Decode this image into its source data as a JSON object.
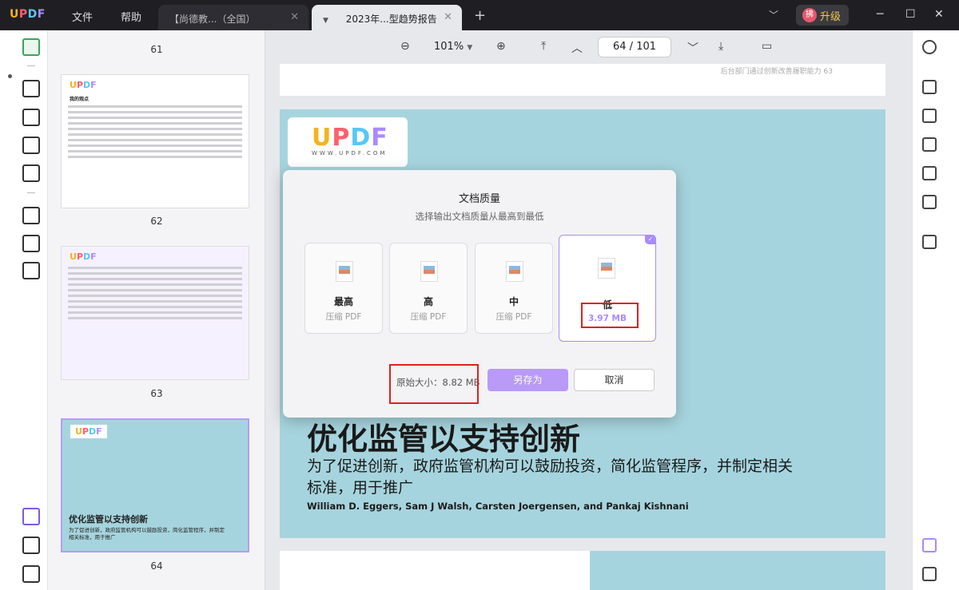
{
  "app": {
    "logo_u": "U",
    "logo_p": "P",
    "logo_d": "D",
    "logo_f": "F"
  },
  "menu": {
    "file": "文件",
    "help": "帮助"
  },
  "tabs": [
    {
      "label": "【尚德教...（全国）",
      "close": "✕"
    },
    {
      "label": "2023年...型趋势报告",
      "close": "✕"
    }
  ],
  "titlebar": {
    "new_tab": "+",
    "upgrade_label": "升级",
    "avatar_text": "拂"
  },
  "toolbar": {
    "zoom_out": "⊖",
    "zoom": "101%",
    "zoom_in": "⊕",
    "current_page": "64",
    "page_sep": "/",
    "total_pages": "101"
  },
  "thumbnails": {
    "pages": [
      "61",
      "62",
      "63",
      "64"
    ],
    "p62_title": "我的观点",
    "p64_heading": "优化监管以支持创新",
    "p64_sub": "为了促进创新，政府监管机构可以鼓励投资，简化监管程序，并制定相关标准，用于推广"
  },
  "document": {
    "top_page_footer": "后台部门通过创新改善履职能力   63",
    "logo_text_u": "U",
    "logo_text_p": "P",
    "logo_text_d": "D",
    "logo_text_f": "F",
    "www": "WWW.UPDF.COM",
    "heading": "优化监管以支持创新",
    "subheading": "为了促进创新，政府监管机构可以鼓励投资，简化监管程序，并制定相关标准，用于推广",
    "authors": "William D. Eggers, Sam J Walsh, Carsten Joergensen, and Pankaj Kishnani"
  },
  "dialog": {
    "title": "文档质量",
    "subtitle": "选择输出文档质量从最高到最低",
    "options": [
      {
        "label": "最高",
        "sub": "压缩 PDF"
      },
      {
        "label": "高",
        "sub": "压缩 PDF"
      },
      {
        "label": "中",
        "sub": "压缩 PDF"
      },
      {
        "label": "低",
        "sub": "3.97 MB"
      }
    ],
    "check": "✓",
    "original_size": "原始大小：8.82 MB",
    "save_as": "另存为",
    "cancel": "取消"
  },
  "colors": {
    "accent": "#b99af7",
    "highlight": "#e02020",
    "page_bg": "#a6d4de"
  }
}
